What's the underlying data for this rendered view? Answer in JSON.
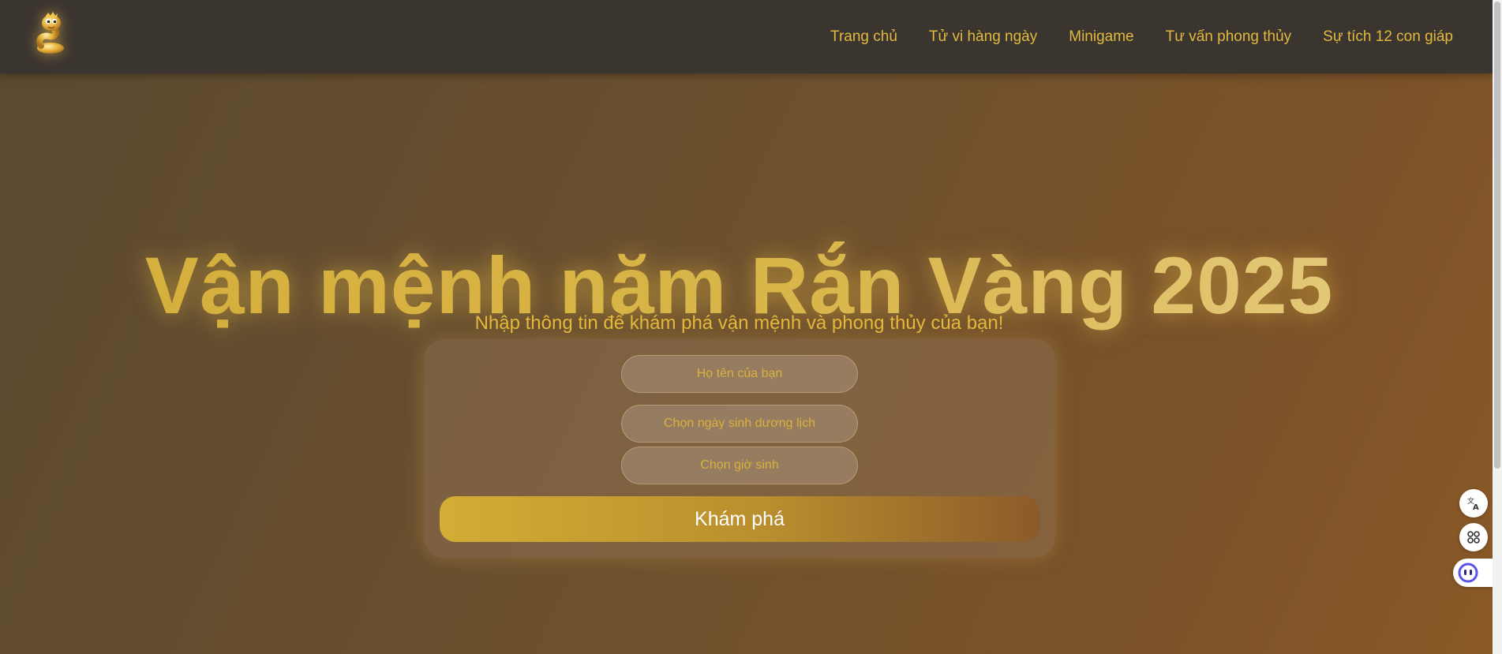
{
  "header": {
    "logo_icon": "golden-snake-mascot-icon",
    "nav": [
      {
        "label": "Trang chủ"
      },
      {
        "label": "Tử vi hàng ngày"
      },
      {
        "label": "Minigame"
      },
      {
        "label": "Tư vấn phong thủy"
      },
      {
        "label": "Sự tích 12 con giáp"
      }
    ]
  },
  "hero": {
    "title": "Vận mệnh năm Rắn Vàng 2025",
    "subtitle": "Nhập thông tin để khám phá vận mệnh và phong thủy của bạn!"
  },
  "form": {
    "name_placeholder": "Họ tên của bạn",
    "birthdate_placeholder": "Chọn ngày sinh dương lịch",
    "birthtime_placeholder": "Chọn giờ sinh",
    "submit_label": "Khám phá"
  },
  "floating_tools": {
    "icons": [
      "translate-icon",
      "apps-grid-icon",
      "assistant-face-icon"
    ]
  },
  "colors": {
    "accent_gold": "#e2b93f",
    "header_bg": "#3b3530",
    "button_gradient_start": "#d3ad35",
    "button_gradient_end": "#8c5a2a"
  }
}
